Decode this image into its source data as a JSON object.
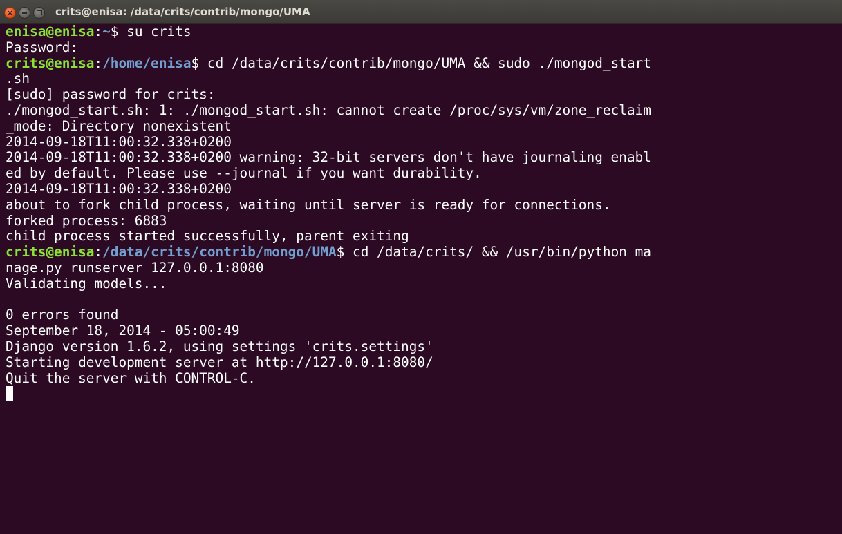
{
  "window": {
    "title": "crits@enisa: /data/crits/contrib/mongo/UMA",
    "close_glyph": "×",
    "colors": {
      "background": "#2c0a24",
      "prompt_user": "#8ae234",
      "prompt_path": "#729fcf",
      "text": "#ffffff"
    }
  },
  "terminal": {
    "line1": {
      "user": "enisa@enisa",
      "sep": ":",
      "path": "~",
      "sign": "$",
      "cmd": " su crits"
    },
    "line2": "Password:",
    "line3": {
      "user": "crits@enisa",
      "sep": ":",
      "path": "/home/enisa",
      "sign": "$",
      "cmd": " cd /data/crits/contrib/mongo/UMA && sudo ./mongod_start"
    },
    "line4": ".sh",
    "line5": "[sudo] password for crits:",
    "line6": "./mongod_start.sh: 1: ./mongod_start.sh: cannot create /proc/sys/vm/zone_reclaim",
    "line7": "_mode: Directory nonexistent",
    "line8": "2014-09-18T11:00:32.338+0200",
    "line9": "2014-09-18T11:00:32.338+0200 warning: 32-bit servers don't have journaling enabl",
    "line10": "ed by default. Please use --journal if you want durability.",
    "line11": "2014-09-18T11:00:32.338+0200",
    "line12": "about to fork child process, waiting until server is ready for connections.",
    "line13": "forked process: 6883",
    "line14": "child process started successfully, parent exiting",
    "line15": {
      "user": "crits@enisa",
      "sep": ":",
      "path": "/data/crits/contrib/mongo/UMA",
      "sign": "$",
      "cmd": " cd /data/crits/ && /usr/bin/python ma"
    },
    "line16": "nage.py runserver 127.0.0.1:8080",
    "line17": "Validating models...",
    "line18": "",
    "line19": "0 errors found",
    "line20": "September 18, 2014 - 05:00:49",
    "line21": "Django version 1.6.2, using settings 'crits.settings'",
    "line22": "Starting development server at http://127.0.0.1:8080/",
    "line23": "Quit the server with CONTROL-C."
  }
}
